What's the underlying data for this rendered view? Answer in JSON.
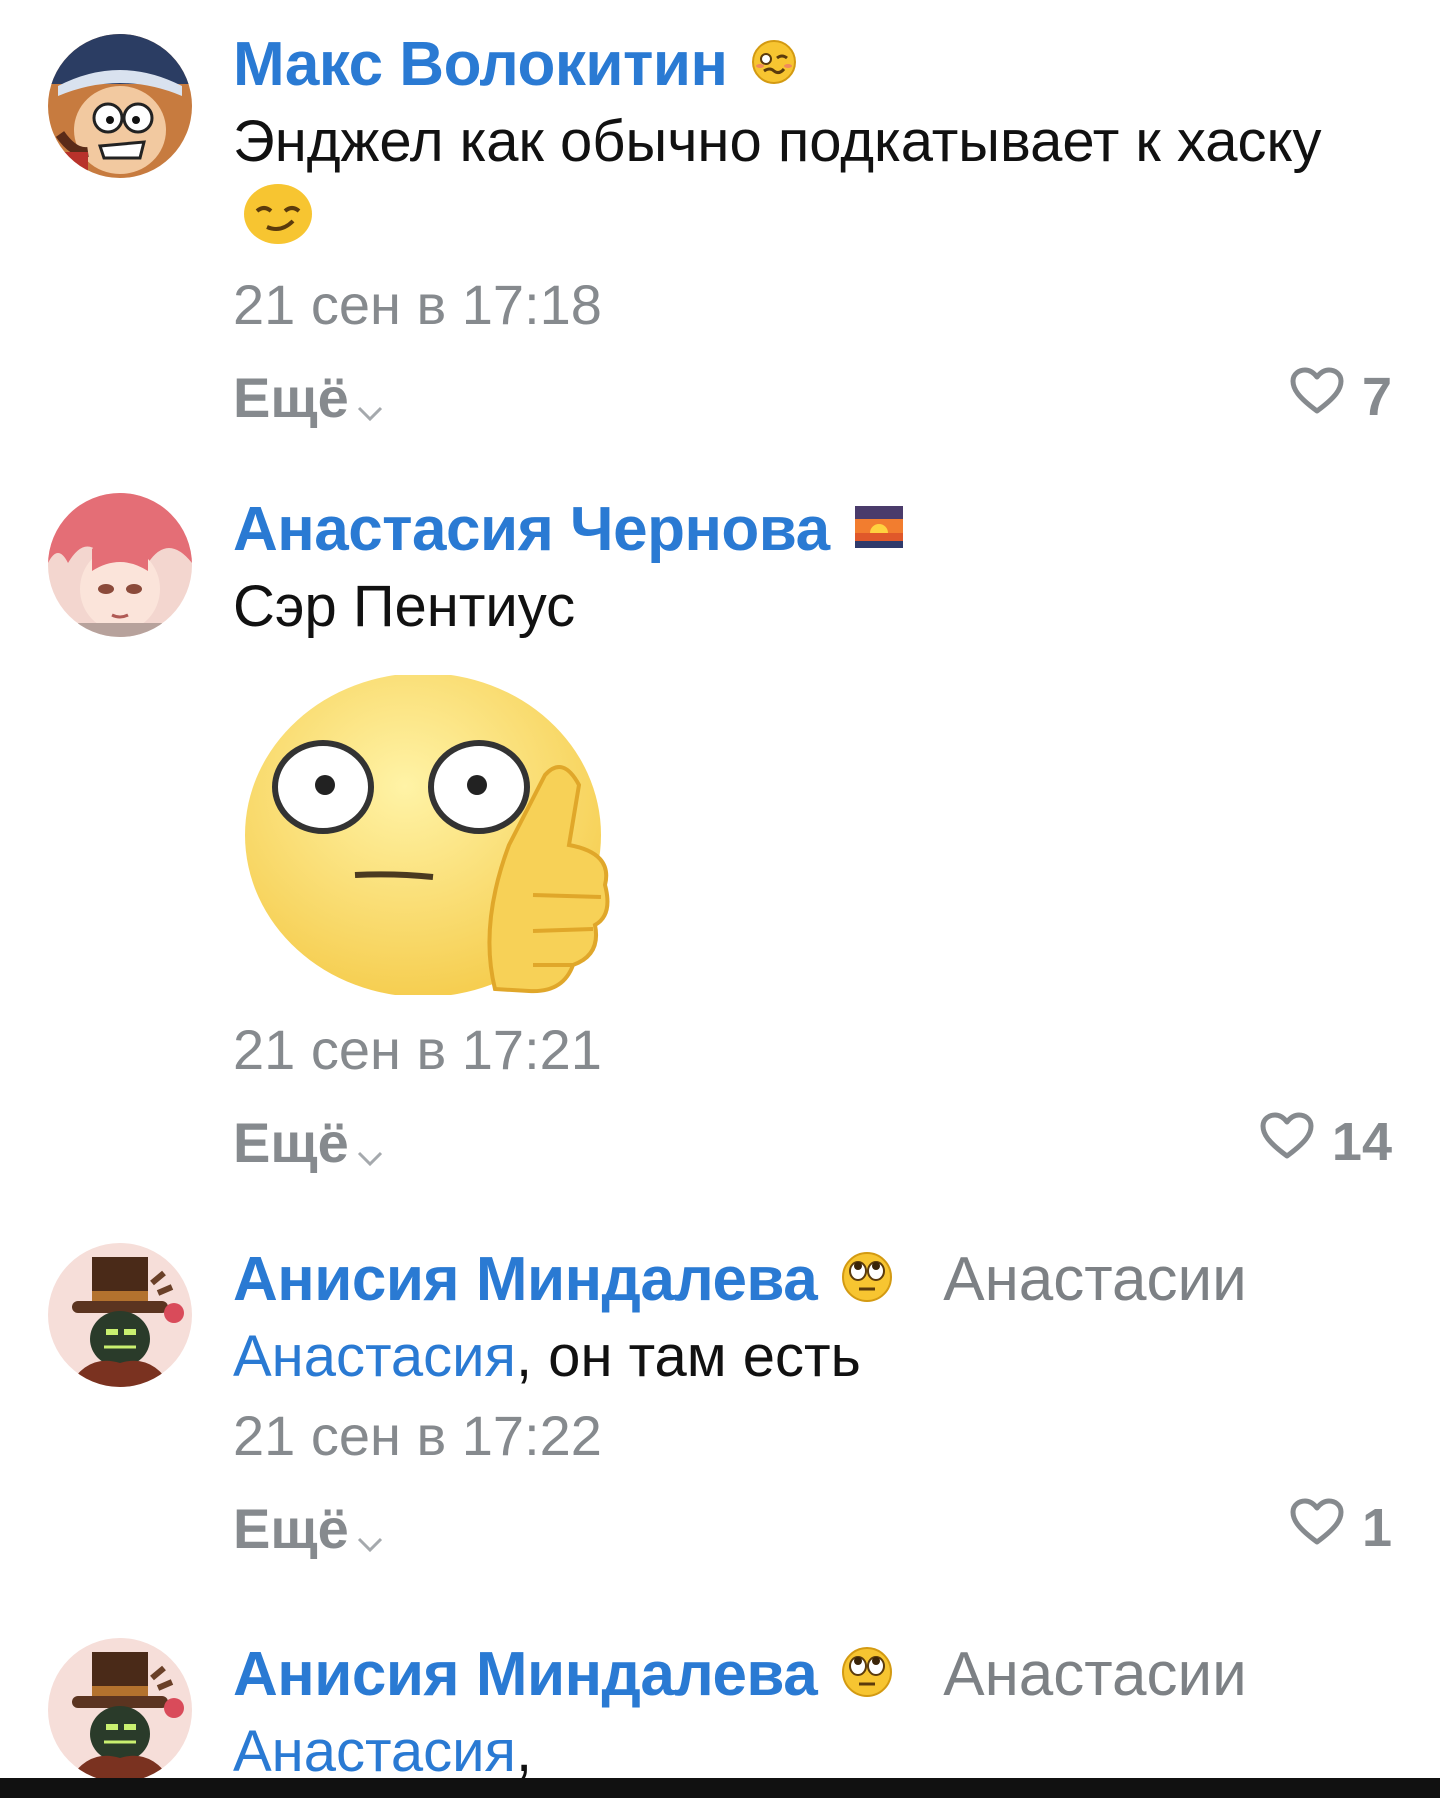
{
  "comments": [
    {
      "author": "Макс Волокитин",
      "status_emoji": "woozy-face-icon",
      "reply_to": "",
      "mention": "",
      "text": "Энджел как обычно подкатывает к хаску",
      "text_emoji": "smirking-face-icon",
      "date": "21 сен в 17:18",
      "more_label": "Ещё",
      "likes": "7"
    },
    {
      "author": "Анастасия Чернова",
      "status_emoji": "sunset-icon",
      "reply_to": "",
      "mention": "",
      "text": "Сэр Пентиус",
      "sticker": "thumbs-up-smiley-sticker",
      "date": "21 сен в 17:21",
      "more_label": "Ещё",
      "likes": "14"
    },
    {
      "author": "Анисия Миндалева",
      "status_emoji": "rolling-eyes-icon",
      "reply_to": "Анастасии",
      "mention": "Анастасия",
      "text": ", он там есть",
      "date": "21 сен в 17:22",
      "more_label": "Ещё",
      "likes": "1"
    },
    {
      "author": "Анисия Миндалева",
      "status_emoji": "rolling-eyes-icon",
      "reply_to": "Анастасии",
      "mention": "Анастасия",
      "text": ","
    }
  ],
  "colors": {
    "link": "#2a7ad3",
    "muted": "#868a8e",
    "text": "#111111"
  }
}
